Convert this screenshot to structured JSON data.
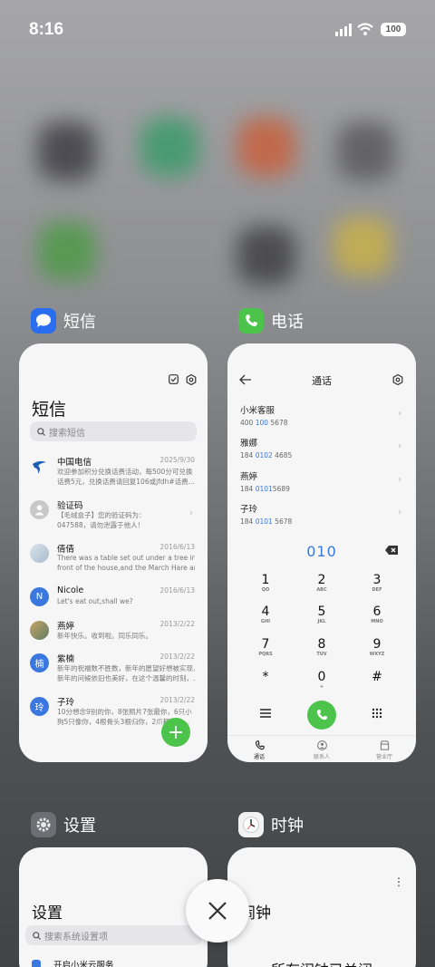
{
  "status": {
    "time": "8:16",
    "battery": "100"
  },
  "colors": {
    "accent_green": "#4cc44c",
    "accent_blue": "#3a78e0",
    "sms_icon": "#2a6ef0"
  },
  "apps": {
    "sms": {
      "header_label": "短信",
      "title": "短信",
      "search_placeholder": "搜索短信",
      "messages": [
        {
          "name": "中国电信",
          "date": "2025/9/30",
          "lines": [
            "欢迎参加积分兑换话费活动，每500分可兑换",
            "话费5元，兑换话费请回复106或jfdh#话费..."
          ],
          "avatar_text": "",
          "avatar_color": "#ffffff"
        },
        {
          "name": "验证码",
          "date": "",
          "lines": [
            "【毛绒盒子】您的验证码为：",
            "047588，请勿泄露于他人！"
          ],
          "avatar_text": "",
          "avatar_color": "#c8c8c8"
        },
        {
          "name": "倩倩",
          "date": "2016/6/13",
          "lines": [
            "There was a table set out under a tree in",
            "front of the house,and the March Hare an..."
          ],
          "avatar_text": "",
          "avatar_color": "#b9c9d8"
        },
        {
          "name": "Nicole",
          "date": "2016/6/13",
          "lines": [
            "Let's eat out,shall we?"
          ],
          "avatar_text": "N",
          "avatar_color": "#3a78e0"
        },
        {
          "name": "燕婷",
          "date": "2013/2/22",
          "lines": [
            "新年快乐。收到啦。同乐同乐。"
          ],
          "avatar_text": "",
          "avatar_color": "#7a9a6e"
        },
        {
          "name": "紫楠",
          "date": "2013/2/22",
          "lines": [
            "新年的祝福数不胜数，新年的愿望好想被实现，",
            "新年的问候依旧也美好，在这个温馨的时刻，..."
          ],
          "avatar_text": "楠",
          "avatar_color": "#3a78e0"
        },
        {
          "name": "子玲",
          "date": "2013/2/22",
          "lines": [
            "10分想念9别的你，8张照片7张最你，6只小",
            "狗5只像你，4根骨头3根归你，2爪都给你..."
          ],
          "avatar_text": "玲",
          "avatar_color": "#3a78e0"
        }
      ]
    },
    "phone": {
      "header_label": "电话",
      "title": "通话",
      "contacts": [
        {
          "name": "小米客服",
          "num_pre": "400 ",
          "num_hl": "100",
          "num_post": " 5678"
        },
        {
          "name": "雅娜",
          "num_pre": "184 ",
          "num_hl": "0102",
          "num_post": " 4685"
        },
        {
          "name": "燕婷",
          "num_pre": "184 ",
          "num_hl": "0101",
          "num_post": "5689"
        },
        {
          "name": "子玲",
          "num_pre": "184 ",
          "num_hl": "0101",
          "num_post": " 5678"
        }
      ],
      "dialed": "010",
      "keys": [
        {
          "d": "1",
          "l": "QO"
        },
        {
          "d": "2",
          "l": "ABC"
        },
        {
          "d": "3",
          "l": "DEF"
        },
        {
          "d": "4",
          "l": "GHI"
        },
        {
          "d": "5",
          "l": "JKL"
        },
        {
          "d": "6",
          "l": "MNO"
        },
        {
          "d": "7",
          "l": "PQRS"
        },
        {
          "d": "8",
          "l": "TUV"
        },
        {
          "d": "9",
          "l": "WXYZ"
        },
        {
          "d": "*",
          "l": ""
        },
        {
          "d": "0",
          "l": "+"
        },
        {
          "d": "#",
          "l": ""
        }
      ],
      "tabs": [
        "通话",
        "联系人",
        "营业厅"
      ]
    },
    "settings": {
      "header_label": "设置",
      "title": "设置",
      "search_placeholder": "搜索系统设置项",
      "first_item": "开启小米云服务"
    },
    "clock": {
      "header_label": "时钟",
      "title": "闹钟",
      "message": "所有闹钟已关闭"
    }
  }
}
